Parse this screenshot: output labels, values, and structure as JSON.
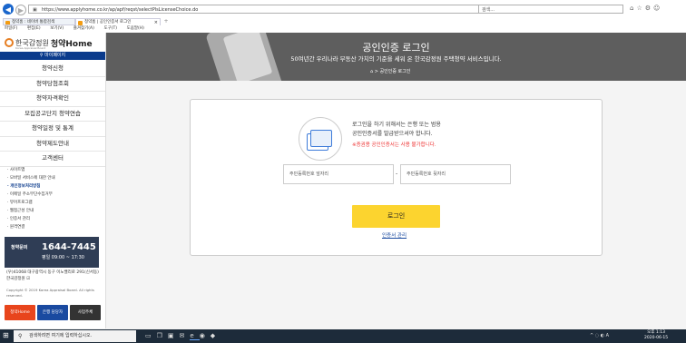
{
  "browser": {
    "url": "https://www.applyhome.co.kr/ap/apf/reqst/selectPlsLicenseChoice.do",
    "search_placeholder": "검색...",
    "tabs": [
      {
        "label": "청약홈 : 네이버 통합검색"
      },
      {
        "label": "청약홈 | 공인인증서 로그인"
      }
    ],
    "menu": [
      "파일(F)",
      "편집(E)",
      "보기(V)",
      "즐겨찾기(A)",
      "도구(T)",
      "도움말(H)"
    ]
  },
  "sidebar": {
    "logo_kr": "한국감정원",
    "logo_home": "청약Home",
    "logo_sub": "Korea Appraisal Board",
    "mypage": "마이페이지",
    "menu": [
      {
        "label": "청약신청"
      },
      {
        "label": "청약당첨조회"
      },
      {
        "label": "청약자격확인"
      },
      {
        "label": "모집공고단지 청약연습"
      },
      {
        "label": "청약일정 및 통계"
      },
      {
        "label": "청약제도안내"
      },
      {
        "label": "고객센터"
      }
    ],
    "sub_links": [
      {
        "label": "· 사이트맵"
      },
      {
        "label": "· 모바일 서비스에 대한 안내"
      },
      {
        "label": "· 개인정보처리방침"
      },
      {
        "label": "· 이메일 주소무단수집거부"
      },
      {
        "label": "· 뷰어프로그램"
      },
      {
        "label": "· 웹접근성 안내"
      },
      {
        "label": "· 인증서 관리"
      },
      {
        "label": "· 원격연결"
      }
    ],
    "call": {
      "label": "청약문의",
      "number": "1644-7445",
      "hours": "평일 09:00 ~ 17:30"
    },
    "address": "(우)41068 대구광역시 동구 이노밸리로 291(신서동) 한국감정원 ☑",
    "copyright": "Copyright © 2019 Korea Appraisal Board. All rights reserved.",
    "bottom_buttons": [
      {
        "label": "청약Home"
      },
      {
        "label": "은행 담당자"
      },
      {
        "label": "사업주체"
      }
    ]
  },
  "hero": {
    "title": "공인인증 로그인",
    "subtitle": "50여년간 우리나라 부동산 가치의 기준을 세워 온 한국감정원 주택청약 서비스입니다.",
    "breadcrumb": "공인인증 로그인"
  },
  "login": {
    "text_line1": "로그인을 하기 위해서는 은행 또는 범용",
    "text_line2": "공인인증서를 발급받으셔야 합니다.",
    "warning": "※증권용 공인인증서는 사용 불가합니다.",
    "id_front_placeholder": "주민등록번호 앞자리",
    "id_back_placeholder": "주민등록번호 뒷자리",
    "dash": "-",
    "login_button": "로그인",
    "cert_link": "인증서 관리"
  },
  "taskbar": {
    "search_placeholder": "검색하려면 여기에 입력하십시오.",
    "time": "오후 1:13",
    "date": "2020-06-15"
  }
}
